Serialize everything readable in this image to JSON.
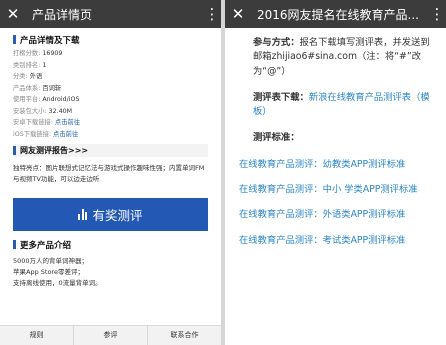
{
  "left": {
    "appbar": {
      "close": "✕",
      "title": "产品详情页",
      "more": "⋮"
    },
    "section_details": "产品详情及下载",
    "info": [
      {
        "label": "打榜分数: ",
        "value": "16909"
      },
      {
        "label": "类别排名: ",
        "value": "1"
      },
      {
        "label": "分类: ",
        "value": "外语"
      },
      {
        "label": "产品体系: ",
        "value": "百词斩"
      },
      {
        "label": "使用平台: ",
        "value": "Android/iOS"
      },
      {
        "label": "安装包大小: ",
        "value": "32.40M"
      },
      {
        "label": "安卓下载链接: ",
        "link": "点击前往"
      },
      {
        "label": "iOS下载链接: ",
        "link": "点击前往"
      }
    ],
    "review_header": "网友测评报告>>>",
    "feature": "独特亮点：图片联想式记忆法与游戏式操作趣味性强；内置单词FM与视频TV功能，可以边走边听",
    "big_button": "有奖测评",
    "more_header": "更多产品介绍",
    "intro_lines": [
      "5000万人的背单词神器；",
      "苹果App Store零差评；",
      "支持离线使用，0流量背单词。"
    ],
    "tabs": [
      "规则",
      "参评",
      "联系合作"
    ]
  },
  "right": {
    "appbar": {
      "close": "✕",
      "title": "2016网友提名在线教育产品...",
      "more": "⋮"
    },
    "participate_label": "参与方式：",
    "participate_text": "报名下载填写测评表，并发送到邮箱zhijiao6#sina.com（注：将“#”改为“@”）",
    "form_label": "测评表下载：",
    "form_link": "新浪在线教育产品测评表（模板）",
    "standard_label": "测评标准：",
    "standards": [
      "在线教育产品测评：幼教类APP测评标准",
      "在线教育产品测评：中小  学类APP测评标准",
      "在线教育产品测评：外语类APP测评标准",
      "在线教育产品测评：考试类APP测评标准"
    ]
  }
}
